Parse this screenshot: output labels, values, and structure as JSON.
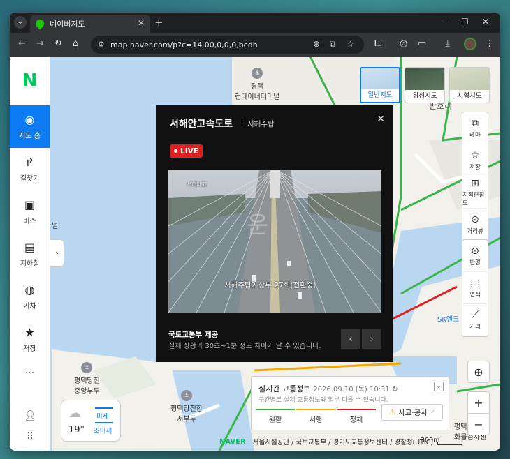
{
  "browser": {
    "tab_title": "네이버지도",
    "url": "map.naver.com/p?c=14.00,0,0,0,bcdh"
  },
  "sidebar": {
    "logo": "N",
    "items": [
      {
        "label": "지도 홈",
        "icon": "map-pin-icon"
      },
      {
        "label": "길찾기",
        "icon": "directions-icon"
      },
      {
        "label": "버스",
        "icon": "bus-icon"
      },
      {
        "label": "지하철",
        "icon": "subway-icon"
      },
      {
        "label": "기차",
        "icon": "train-icon"
      },
      {
        "label": "저장",
        "icon": "star-icon"
      },
      {
        "label": "···",
        "icon": "more-icon"
      }
    ]
  },
  "map_types": [
    {
      "label": "일반지도",
      "selected": true
    },
    {
      "label": "위성지도",
      "selected": false
    },
    {
      "label": "지형지도",
      "selected": false
    }
  ],
  "right_tools": [
    {
      "label": "테마",
      "icon": "layers-icon"
    },
    {
      "label": "저장",
      "icon": "star-icon"
    },
    {
      "label": "지적편집도",
      "icon": "grid-icon"
    },
    {
      "label": "거리뷰",
      "icon": "streetview-icon"
    }
  ],
  "measure_tools": [
    {
      "label": "반경",
      "icon": "radius-icon"
    },
    {
      "label": "면적",
      "icon": "area-icon"
    },
    {
      "label": "거리",
      "icon": "ruler-icon"
    }
  ],
  "cctv": {
    "title": "서해안고속도로",
    "subtitle": "서해주탑",
    "live_label": "LIVE",
    "video_caption": "서해주탑2   상부  27회(전환중)",
    "video_top": "서해대교",
    "provider": "국토교통부 제공",
    "notice": "실제 상황과 30초~1분 정도 차이가 날 수 있습니다."
  },
  "traffic": {
    "title": "실시간 교통정보",
    "timestamp": "2026.09.10 (목) 10:31",
    "note": "구간별로 실제 교통정보와 일부 다를 수 있습니다.",
    "legend": [
      {
        "label": "원활",
        "color": "#3ab54a"
      },
      {
        "label": "서행",
        "color": "#f2a900"
      },
      {
        "label": "정체",
        "color": "#e02020"
      }
    ],
    "accident_label": "사고·공사"
  },
  "weather": {
    "temperature": "19°",
    "dust": "미세",
    "ultrafine_dust": "조미세"
  },
  "footer": {
    "brand": "NAVER",
    "credits": "서울시설공단 / 국토교통부 / 경기도교통정보센터 / 경찰청(UTIC)",
    "scale": "300m"
  },
  "map_labels": {
    "port_terminal": "평택\n컨테이너터미널",
    "banhori": "반호리",
    "sk": "SK엔크",
    "dangjin_pier": "평택당진\n중앙부두",
    "west_pier": "평택당진항\n서부두",
    "cargo": "평택\n화물검사센",
    "partial_left": "널"
  }
}
